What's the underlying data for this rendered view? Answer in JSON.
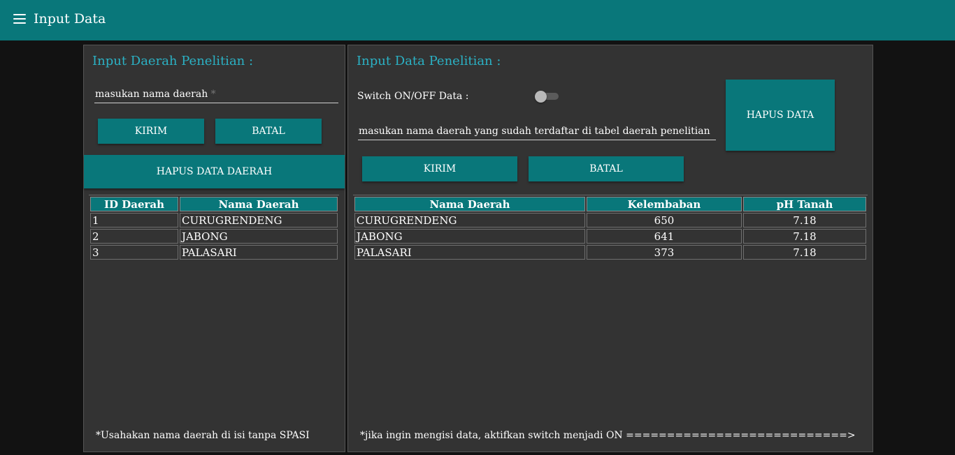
{
  "header": {
    "title": "Input Data",
    "menu_icon": "hamburger-menu-icon"
  },
  "left_panel": {
    "title": "Input Daerah Penelitian :",
    "input": {
      "label": "masukan nama daerah",
      "required_mark": "*",
      "value": ""
    },
    "buttons": {
      "submit": "KIRIM",
      "cancel": "BATAL",
      "delete_all": "HAPUS DATA DAERAH"
    },
    "table": {
      "headers": [
        "ID Daerah",
        "Nama Daerah"
      ],
      "rows": [
        [
          "1",
          "CURUGRENDENG"
        ],
        [
          "2",
          "JABONG"
        ],
        [
          "3",
          "PALASARI"
        ]
      ]
    },
    "note": "*Usahakan nama daerah di isi tanpa SPASI"
  },
  "right_panel": {
    "title": "Input Data Penelitian :",
    "switch": {
      "label": "Switch ON/OFF Data :",
      "state": "off"
    },
    "input": {
      "label": "masukan nama daerah yang sudah terdaftar di tabel daerah penelitian",
      "value": ""
    },
    "buttons": {
      "delete": "HAPUS DATA",
      "submit": "KIRIM",
      "cancel": "BATAL"
    },
    "table": {
      "headers": [
        "Nama Daerah",
        "Kelembaban",
        "pH Tanah"
      ],
      "rows": [
        [
          "CURUGRENDENG",
          "650",
          "7.18"
        ],
        [
          "JABONG",
          "641",
          "7.18"
        ],
        [
          "PALASARI",
          "373",
          "7.18"
        ]
      ]
    },
    "note": "*jika ingin mengisi data, aktifkan switch menjadi ON ===========================>"
  },
  "colors": {
    "appbar": "#09777a",
    "accent_text": "#2bb1c4",
    "panel": "#333333",
    "background": "#121212"
  }
}
